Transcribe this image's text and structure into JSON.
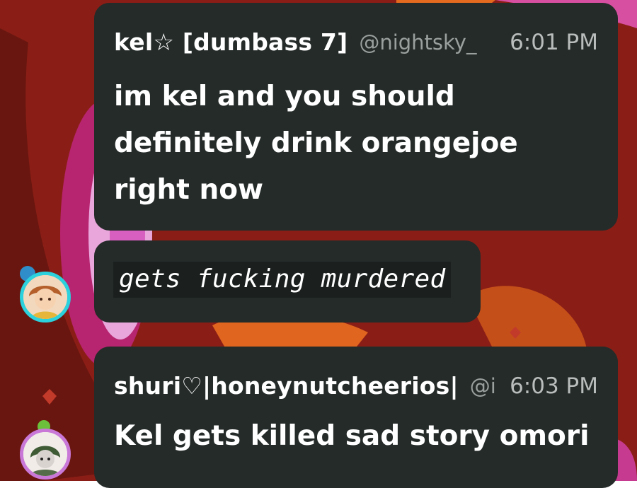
{
  "colors": {
    "background": "#8a1e16",
    "bubble": "#242b29",
    "code_block": "#1b201f",
    "text_primary": "#ffffff",
    "text_secondary": "#9aa09d",
    "kel_avatar_ring": "#2bd1dc",
    "shuri_avatar_ring": "#c978d8"
  },
  "messages": [
    {
      "username": "kel☆ [dumbass 7]",
      "handle": "@nightsky_",
      "time": "6:01 PM",
      "text": "im kel and you should definitely drink orangejoe right now"
    },
    {
      "code_text": "gets fucking murdered",
      "avatar_icon": "kel-avatar-icon"
    },
    {
      "username": "shuri♡|honeynutcheerios|",
      "handle": "@i",
      "time": "6:03 PM",
      "text": "Kel gets killed sad story omori",
      "avatar_icon": "shuri-avatar-icon"
    }
  ]
}
